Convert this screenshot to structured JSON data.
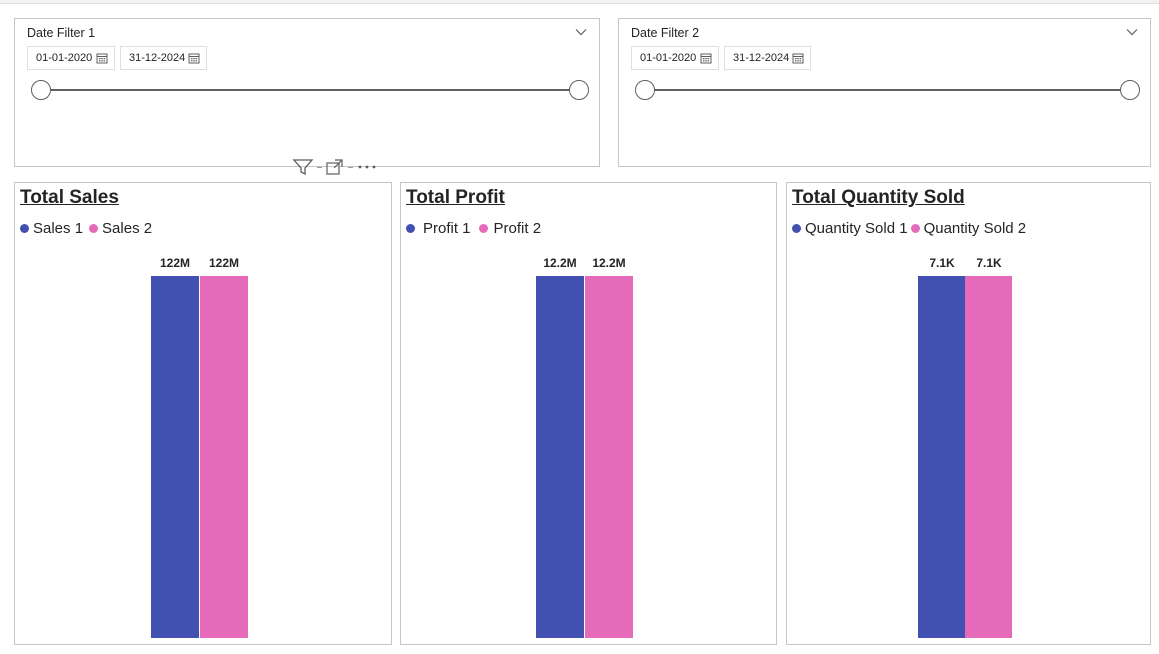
{
  "colors": {
    "series1": "#4150b1",
    "series2": "#e56bba"
  },
  "filters": [
    {
      "title": "Date Filter 1",
      "start": "01-01-2020",
      "end": "31-12-2024",
      "chevron_icon": "chevron-down-icon",
      "calendar_icon": "calendar-icon"
    },
    {
      "title": "Date Filter 2",
      "start": "01-01-2020",
      "end": "31-12-2024",
      "chevron_icon": "chevron-down-icon",
      "calendar_icon": "calendar-icon"
    }
  ],
  "visual_header": {
    "icons": [
      "filter-icon",
      "focus-mode-icon",
      "more-options-icon"
    ]
  },
  "cards": [
    {
      "title": "Total Sales",
      "chart_data": {
        "type": "bar",
        "series": [
          {
            "name": "Sales 1",
            "value": 122000000,
            "label": "122M"
          },
          {
            "name": "Sales 2",
            "value": 122000000,
            "label": "122M"
          }
        ]
      }
    },
    {
      "title": "Total Profit",
      "chart_data": {
        "type": "bar",
        "series": [
          {
            "name": "Profit 1",
            "value": 12200000,
            "label": "12.2M"
          },
          {
            "name": "Profit 2",
            "value": 12200000,
            "label": "12.2M"
          }
        ]
      }
    },
    {
      "title": "Total Quantity Sold",
      "chart_data": {
        "type": "bar",
        "series": [
          {
            "name": "Quantity Sold 1",
            "value": 7100,
            "label": "7.1K"
          },
          {
            "name": "Quantity Sold 2",
            "value": 7100,
            "label": "7.1K"
          }
        ]
      }
    }
  ]
}
